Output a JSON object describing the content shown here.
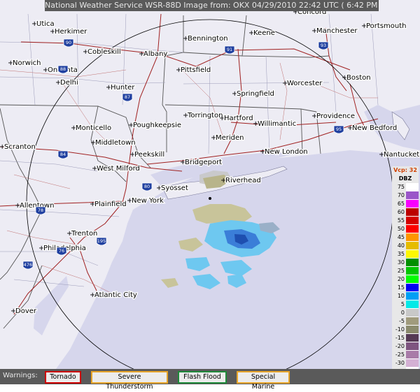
{
  "title": "National Weather Service WSR-88D Image from: OKX 04/29/2010 22:42 UTC ( 6:42 PM EDT)",
  "legend": {
    "header_vcp": "Vcp: 32",
    "header_unit": "DBZ",
    "levels": [
      {
        "label": "75",
        "color": "#ffffff"
      },
      {
        "label": "70",
        "color": "#9a55c9"
      },
      {
        "label": "65",
        "color": "#f800fd"
      },
      {
        "label": "60",
        "color": "#bc0000"
      },
      {
        "label": "55",
        "color": "#d40000"
      },
      {
        "label": "50",
        "color": "#fd0000"
      },
      {
        "label": "45",
        "color": "#fd9500"
      },
      {
        "label": "40",
        "color": "#e5bc00"
      },
      {
        "label": "35",
        "color": "#fdf802"
      },
      {
        "label": "30",
        "color": "#008e00"
      },
      {
        "label": "25",
        "color": "#01c501"
      },
      {
        "label": "20",
        "color": "#02fd02"
      },
      {
        "label": "15",
        "color": "#0300f4"
      },
      {
        "label": "10",
        "color": "#019ff4"
      },
      {
        "label": "5",
        "color": "#04e9e7"
      },
      {
        "label": "0",
        "color": "#c8c8c8"
      },
      {
        "label": "-5",
        "color": "#a09b7d"
      },
      {
        "label": "-10",
        "color": "#8b8b6e"
      },
      {
        "label": "-15",
        "color": "#553a55"
      },
      {
        "label": "-20",
        "color": "#7e5580"
      },
      {
        "label": "-25",
        "color": "#a87ba8"
      },
      {
        "label": "-30",
        "color": "#d4b0d4"
      },
      {
        "label": "ND",
        "color": "#ffffff"
      }
    ]
  },
  "warnings": {
    "label": "Warnings:",
    "items": [
      {
        "label": "Tornado",
        "color": "#cc0000"
      },
      {
        "label": "Severe Thunderstorm",
        "color": "#e8a52a"
      },
      {
        "label": "Flash Flood",
        "color": "#1f8a3a"
      },
      {
        "label": "Special Marine",
        "color": "#e8a52a"
      }
    ]
  },
  "cities": [
    {
      "name": "Utica"
    },
    {
      "name": "Herkimer"
    },
    {
      "name": "Cobleskill"
    },
    {
      "name": "Albany"
    },
    {
      "name": "Bennington"
    },
    {
      "name": "Keene"
    },
    {
      "name": "Concord"
    },
    {
      "name": "Manchester"
    },
    {
      "name": "Portsmouth"
    },
    {
      "name": "Norwich"
    },
    {
      "name": "Oneonta"
    },
    {
      "name": "Delhi"
    },
    {
      "name": "Hunter"
    },
    {
      "name": "Pittsfield"
    },
    {
      "name": "Worcester"
    },
    {
      "name": "Boston"
    },
    {
      "name": "Springfield"
    },
    {
      "name": "Monticello"
    },
    {
      "name": "Poughkeepsie"
    },
    {
      "name": "Torrington"
    },
    {
      "name": "Hartford"
    },
    {
      "name": "Willimantic"
    },
    {
      "name": "Providence"
    },
    {
      "name": "New Bedford"
    },
    {
      "name": "Middletown"
    },
    {
      "name": "Meriden"
    },
    {
      "name": "Scranton"
    },
    {
      "name": "Peekskill"
    },
    {
      "name": "Bridgeport"
    },
    {
      "name": "New London"
    },
    {
      "name": "Nantucket"
    },
    {
      "name": "West Milford"
    },
    {
      "name": "Syosset"
    },
    {
      "name": "Riverhead"
    },
    {
      "name": "Allentown"
    },
    {
      "name": "Plainfield"
    },
    {
      "name": "New York"
    },
    {
      "name": "Trenton"
    },
    {
      "name": "Philadelphia"
    },
    {
      "name": "Atlantic City"
    },
    {
      "name": "Dover"
    }
  ],
  "highways": [
    {
      "label": "90"
    },
    {
      "label": "88"
    },
    {
      "label": "91"
    },
    {
      "label": "87"
    },
    {
      "label": "93"
    },
    {
      "label": "84"
    },
    {
      "label": "95"
    },
    {
      "label": "80"
    },
    {
      "label": "195"
    },
    {
      "label": "476"
    },
    {
      "label": "76"
    },
    {
      "label": "78"
    }
  ],
  "colors": {
    "land": "#ebeaf3",
    "water": "#d6d6ec",
    "background": "#ffffff",
    "ring": "#000000"
  }
}
